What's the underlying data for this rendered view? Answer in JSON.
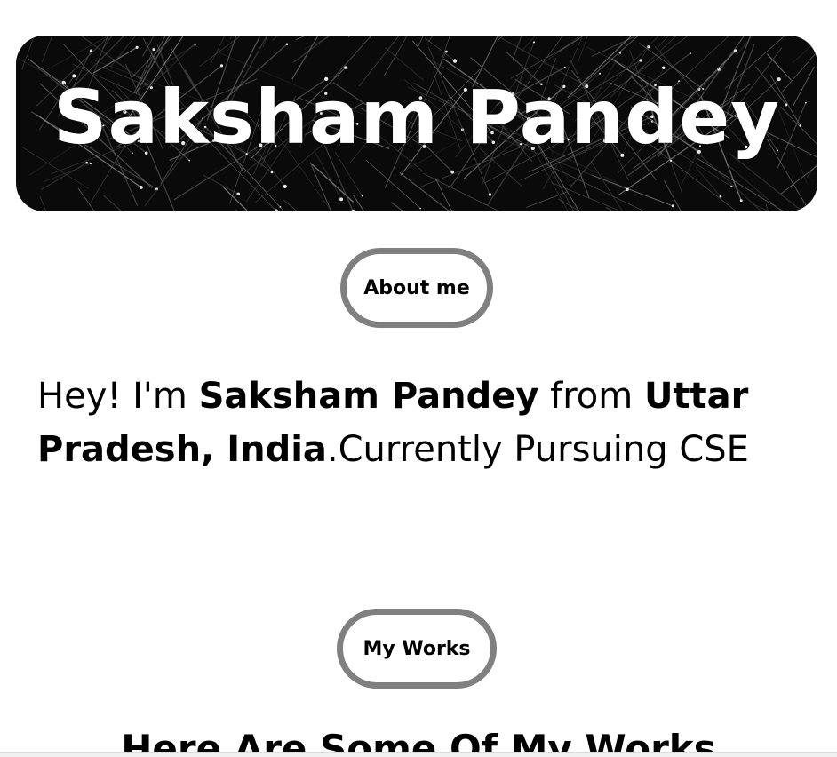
{
  "hero": {
    "title": "Saksham Pandey"
  },
  "about": {
    "button_label": "About me",
    "intro_prefix": "Hey! I'm ",
    "name": "Saksham Pandey",
    "from_text": " from ",
    "location": "Uttar Pradesh, India",
    "suffix": ".Currently Pursuing CSE"
  },
  "works": {
    "button_label": "My Works",
    "heading": "Here Are Some Of My Works"
  }
}
